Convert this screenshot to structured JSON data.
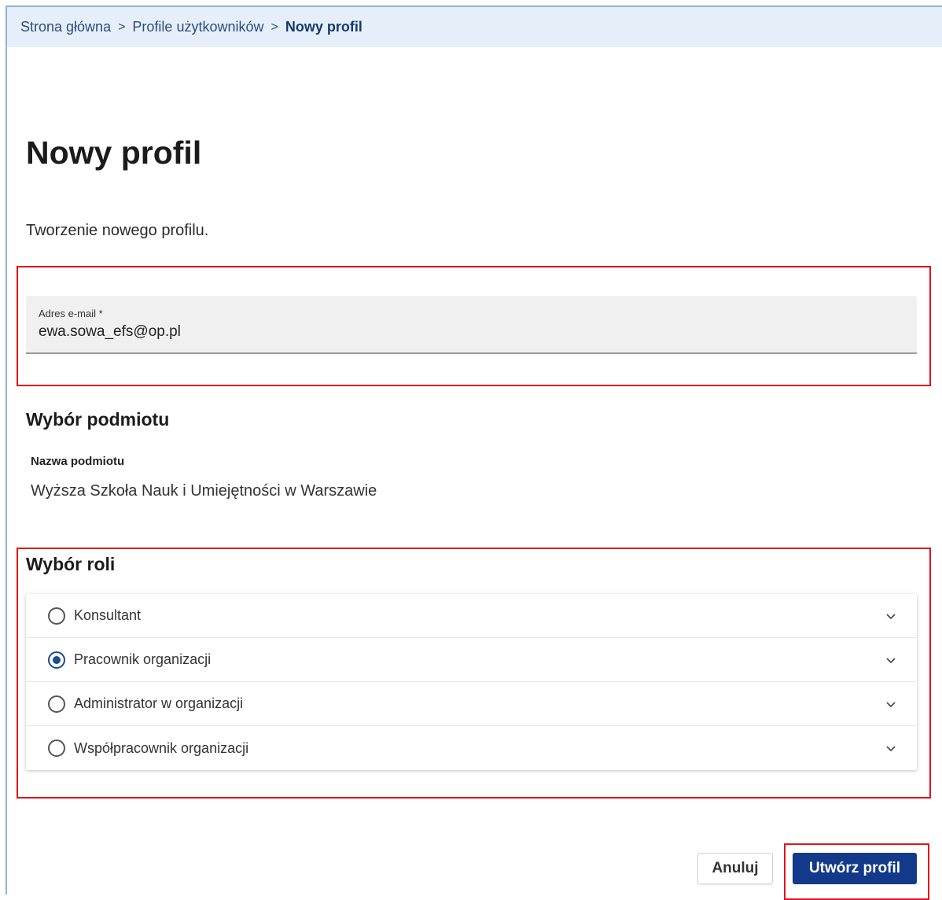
{
  "breadcrumb": {
    "items": [
      "Strona główna",
      "Profile użytkowników"
    ],
    "current": "Nowy profil",
    "separator": ">"
  },
  "page": {
    "title": "Nowy profil",
    "description": "Tworzenie nowego profilu."
  },
  "email": {
    "label": "Adres e-mail *",
    "value": "ewa.sowa_efs@op.pl"
  },
  "entity": {
    "section_title": "Wybór podmiotu",
    "label": "Nazwa podmiotu",
    "value": "Wyższa Szkoła Nauk i Umiejętności w Warszawie"
  },
  "roles": {
    "section_title": "Wybór roli",
    "items": [
      {
        "label": "Konsultant",
        "selected": false
      },
      {
        "label": "Pracownik organizacji",
        "selected": true
      },
      {
        "label": "Administrator w organizacji",
        "selected": false
      },
      {
        "label": "Współpracownik organizacji",
        "selected": false
      }
    ]
  },
  "actions": {
    "cancel_label": "Anuluj",
    "create_label": "Utwórz profil"
  },
  "colors": {
    "highlight": "#e0141c",
    "primary": "#133a8a",
    "breadcrumb_bg": "#e6eff9"
  }
}
